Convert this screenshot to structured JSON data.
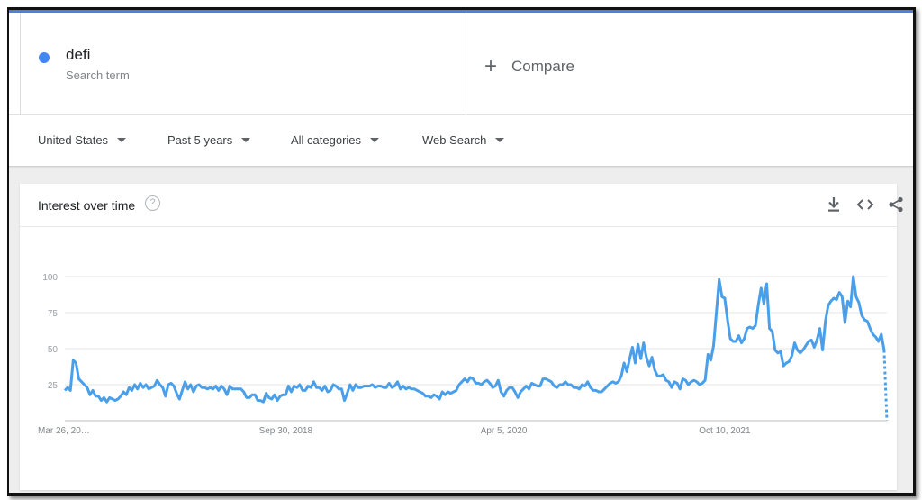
{
  "search": {
    "term": "defi",
    "term_subtitle": "Search term",
    "term_color": "#4285f4",
    "compare_label": "Compare"
  },
  "filters": [
    {
      "label": "United States"
    },
    {
      "label": "Past 5 years"
    },
    {
      "label": "All categories"
    },
    {
      "label": "Web Search"
    }
  ],
  "card": {
    "title": "Interest over time",
    "icons": [
      "help-icon",
      "download-icon",
      "embed-icon",
      "share-icon"
    ]
  },
  "chart_data": {
    "type": "line",
    "title": "",
    "xlabel": "",
    "ylabel": "",
    "ylim": [
      0,
      100
    ],
    "yticks": [
      25,
      50,
      75,
      100
    ],
    "grid": true,
    "x_tick_labels": [
      "Mar 26, 20…",
      "Sep 30, 2018",
      "Apr 5, 2020",
      "Oct 10, 2021"
    ],
    "x_tick_positions": [
      0,
      79,
      157,
      236
    ],
    "line_color": "#4a9fea",
    "series": [
      {
        "values": [
          21,
          23,
          21,
          42,
          40,
          29,
          27,
          25,
          23,
          18,
          21,
          17,
          17,
          14,
          16,
          13,
          16,
          15,
          14,
          15,
          17,
          20,
          18,
          23,
          21,
          25,
          22,
          26,
          23,
          25,
          22,
          23,
          24,
          28,
          25,
          23,
          17,
          25,
          26,
          24,
          19,
          15,
          21,
          27,
          22,
          25,
          20,
          24,
          25,
          23,
          23,
          22,
          23,
          22,
          24,
          21,
          24,
          22,
          18,
          24,
          22,
          22,
          22,
          22,
          20,
          16,
          16,
          18,
          18,
          14,
          14,
          13,
          19,
          16,
          15,
          18,
          14,
          17,
          18,
          18,
          24,
          20,
          24,
          23,
          25,
          21,
          21,
          24,
          23,
          27,
          23,
          23,
          21,
          24,
          20,
          21,
          25,
          24,
          22,
          22,
          14,
          19,
          25,
          21,
          25,
          23,
          23,
          24,
          24,
          24,
          25,
          23,
          24,
          24,
          23,
          23,
          26,
          23,
          24,
          27,
          22,
          24,
          22,
          23,
          22,
          22,
          21,
          20,
          19,
          17,
          17,
          16,
          18,
          17,
          15,
          20,
          18,
          20,
          19,
          20,
          21,
          25,
          27,
          29,
          27,
          30,
          29,
          26,
          26,
          25,
          27,
          28,
          26,
          23,
          24,
          28,
          20,
          17,
          21,
          23,
          23,
          20,
          16,
          20,
          22,
          24,
          22,
          26,
          25,
          24,
          24,
          29,
          29,
          28,
          27,
          24,
          23,
          25,
          25,
          27,
          25,
          25,
          23,
          23,
          22,
          25,
          24,
          27,
          23,
          21,
          21,
          20,
          20,
          22,
          24,
          26,
          27,
          26,
          27,
          31,
          40,
          34,
          43,
          51,
          40,
          53,
          43,
          54,
          44,
          38,
          44,
          35,
          31,
          31,
          32,
          28,
          27,
          23,
          27,
          26,
          22,
          29,
          28,
          25,
          27,
          28,
          27,
          25,
          26,
          28,
          46,
          42,
          52,
          75,
          98,
          86,
          85,
          70,
          57,
          55,
          55,
          59,
          54,
          57,
          64,
          65,
          64,
          66,
          80,
          92,
          81,
          95,
          64,
          62,
          49,
          47,
          48,
          38,
          40,
          41,
          45,
          54,
          49,
          47,
          49,
          52,
          55,
          56,
          51,
          56,
          64,
          49,
          69,
          80,
          83,
          85,
          84,
          89,
          86,
          68,
          83,
          79,
          100,
          86,
          82,
          73,
          70,
          69,
          64,
          60,
          58,
          55,
          60,
          49,
          0
        ]
      }
    ]
  }
}
